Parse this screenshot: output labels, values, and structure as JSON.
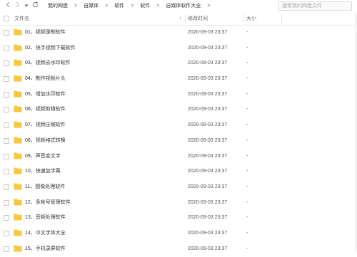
{
  "toolbar": {
    "back_icon": "chevron-left",
    "forward_icon": "chevron-right",
    "dropdown_icon": "caret-down",
    "refresh_icon": "refresh",
    "breadcrumb": [
      "我的网盘",
      "自媒体",
      "软件",
      "软件",
      "自媒体软件大全"
    ],
    "separator": ">",
    "search_placeholder": "搜索我的网盘文件"
  },
  "columns": {
    "name": "文件名",
    "sort_indicator": "↑",
    "date": "修改时间",
    "size": "大小"
  },
  "folder_color": "#f7c83f",
  "rows": [
    {
      "name": "01、视频录制软件",
      "date": "2020-09-03 23:37",
      "size": "-"
    },
    {
      "name": "02、快手视频下载软件",
      "date": "2020-09-03 23:37",
      "size": "-"
    },
    {
      "name": "03、视频去水印软件",
      "date": "2020-09-03 23:37",
      "size": "-"
    },
    {
      "name": "04、制作视频片头",
      "date": "2020-09-03 23:37",
      "size": "-"
    },
    {
      "name": "05、增加水印软件",
      "date": "2020-09-03 23:37",
      "size": "-"
    },
    {
      "name": "06、视频剪辑软件",
      "date": "2020-09-03 23:37",
      "size": "-"
    },
    {
      "name": "07、视频压缩软件",
      "date": "2020-09-03 23:37",
      "size": "-"
    },
    {
      "name": "08、视频格式转换",
      "date": "2020-09-03 23:37",
      "size": "-"
    },
    {
      "name": "09、声音变文字",
      "date": "2020-09-03 23:37",
      "size": "-"
    },
    {
      "name": "10、快速加字幕",
      "date": "2020-09-03 23:37",
      "size": "-"
    },
    {
      "name": "11、图像处理软件",
      "date": "2020-09-03 23:37",
      "size": "-"
    },
    {
      "name": "12、多帐号管理软件",
      "date": "2020-09-03 23:37",
      "size": "-"
    },
    {
      "name": "13、音频处理软件",
      "date": "2020-09-03 23:37",
      "size": "-"
    },
    {
      "name": "14、中文字体大全",
      "date": "2020-09-03 23:37",
      "size": "-"
    },
    {
      "name": "15、手机录屏软件",
      "date": "2020-09-03 23:37",
      "size": "-"
    }
  ]
}
